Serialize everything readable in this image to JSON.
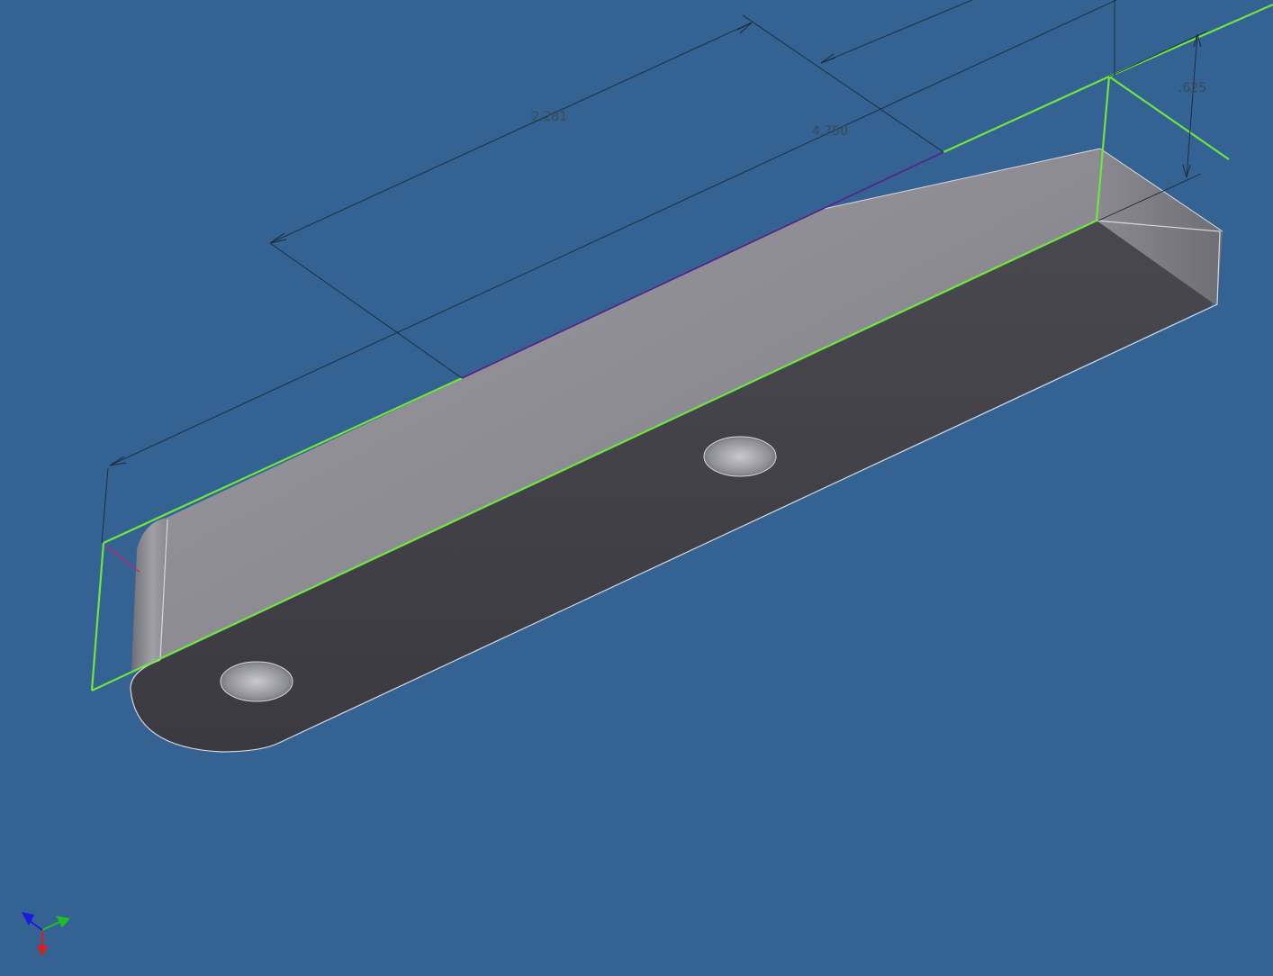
{
  "viewport": {
    "background_color": "#336293",
    "part": {
      "top_face_color": "#8a8a90",
      "side_face_color": "#3e3e44",
      "end_face_color": "#7f7f86",
      "highlight_edge_color": "#6ee63e",
      "hole_count": 2
    }
  },
  "dimensions": [
    {
      "label": "2.281"
    },
    {
      "label": "4.750"
    },
    {
      "label": ".625"
    }
  ],
  "view_cube": {
    "axes": [
      {
        "name": "x",
        "color": "#e11a1a"
      },
      {
        "name": "y",
        "color": "#1fbf2a"
      },
      {
        "name": "z",
        "color": "#1a1ae0"
      }
    ]
  }
}
